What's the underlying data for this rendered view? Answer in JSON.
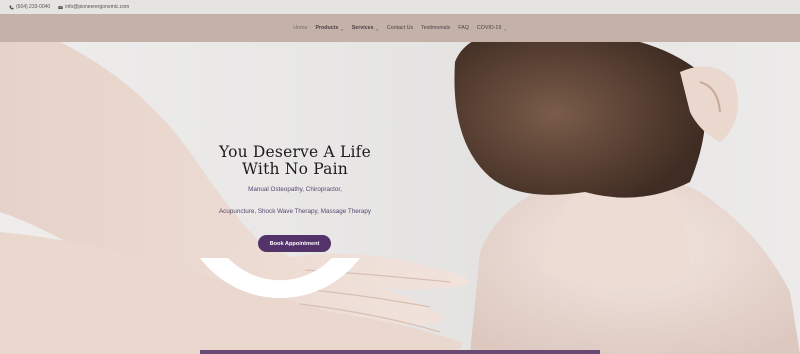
{
  "topbar": {
    "phone": "(604) 233-0040",
    "email": "info@pioneerergonomic.com",
    "phone_icon": "phone-icon",
    "email_icon": "envelope-icon"
  },
  "nav": {
    "items": [
      {
        "label": "Home",
        "has_dropdown": false,
        "active": true
      },
      {
        "label": "Products",
        "has_dropdown": true,
        "active": false
      },
      {
        "label": "Services",
        "has_dropdown": true,
        "active": false
      },
      {
        "label": "Contact Us",
        "has_dropdown": false,
        "active": false
      },
      {
        "label": "Testimonials",
        "has_dropdown": false,
        "active": false
      },
      {
        "label": "FAQ",
        "has_dropdown": false,
        "active": false
      },
      {
        "label": "COVID-19",
        "has_dropdown": true,
        "active": false
      }
    ]
  },
  "hero": {
    "title_line1": "You Deserve A Life",
    "title_line2": "With No Pain",
    "services_line1": "Manual Osteopathy, Chiropractor,",
    "services_line2": "Acupuncture, Shock Wave Therapy,  Massage Therapy",
    "button_label": "Book Appointment"
  },
  "colors": {
    "nav_bg": "#c4b2a9",
    "button_bg": "#54336a",
    "accent_text": "#5a4570"
  }
}
